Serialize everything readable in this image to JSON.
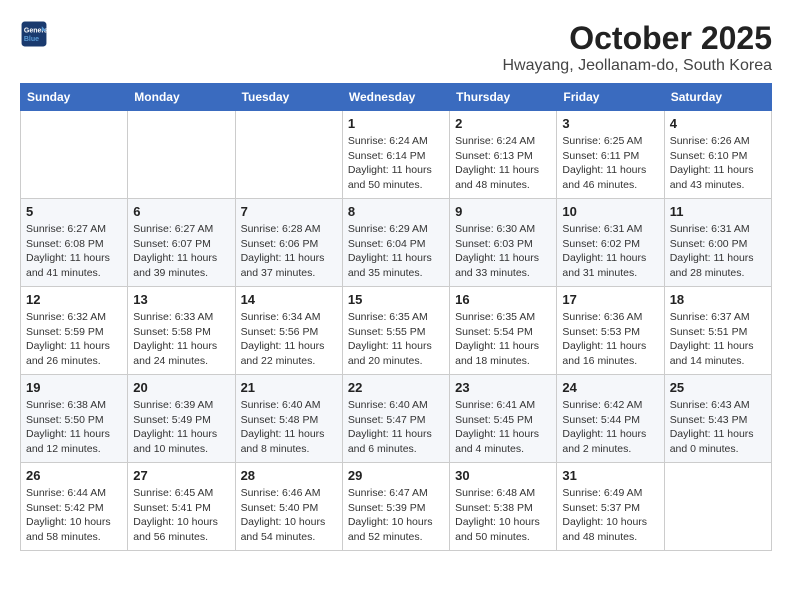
{
  "header": {
    "logo_line1": "General",
    "logo_line2": "Blue",
    "month": "October 2025",
    "location": "Hwayang, Jeollanam-do, South Korea"
  },
  "weekdays": [
    "Sunday",
    "Monday",
    "Tuesday",
    "Wednesday",
    "Thursday",
    "Friday",
    "Saturday"
  ],
  "weeks": [
    [
      {
        "day": "",
        "info": ""
      },
      {
        "day": "",
        "info": ""
      },
      {
        "day": "",
        "info": ""
      },
      {
        "day": "1",
        "info": "Sunrise: 6:24 AM\nSunset: 6:14 PM\nDaylight: 11 hours\nand 50 minutes."
      },
      {
        "day": "2",
        "info": "Sunrise: 6:24 AM\nSunset: 6:13 PM\nDaylight: 11 hours\nand 48 minutes."
      },
      {
        "day": "3",
        "info": "Sunrise: 6:25 AM\nSunset: 6:11 PM\nDaylight: 11 hours\nand 46 minutes."
      },
      {
        "day": "4",
        "info": "Sunrise: 6:26 AM\nSunset: 6:10 PM\nDaylight: 11 hours\nand 43 minutes."
      }
    ],
    [
      {
        "day": "5",
        "info": "Sunrise: 6:27 AM\nSunset: 6:08 PM\nDaylight: 11 hours\nand 41 minutes."
      },
      {
        "day": "6",
        "info": "Sunrise: 6:27 AM\nSunset: 6:07 PM\nDaylight: 11 hours\nand 39 minutes."
      },
      {
        "day": "7",
        "info": "Sunrise: 6:28 AM\nSunset: 6:06 PM\nDaylight: 11 hours\nand 37 minutes."
      },
      {
        "day": "8",
        "info": "Sunrise: 6:29 AM\nSunset: 6:04 PM\nDaylight: 11 hours\nand 35 minutes."
      },
      {
        "day": "9",
        "info": "Sunrise: 6:30 AM\nSunset: 6:03 PM\nDaylight: 11 hours\nand 33 minutes."
      },
      {
        "day": "10",
        "info": "Sunrise: 6:31 AM\nSunset: 6:02 PM\nDaylight: 11 hours\nand 31 minutes."
      },
      {
        "day": "11",
        "info": "Sunrise: 6:31 AM\nSunset: 6:00 PM\nDaylight: 11 hours\nand 28 minutes."
      }
    ],
    [
      {
        "day": "12",
        "info": "Sunrise: 6:32 AM\nSunset: 5:59 PM\nDaylight: 11 hours\nand 26 minutes."
      },
      {
        "day": "13",
        "info": "Sunrise: 6:33 AM\nSunset: 5:58 PM\nDaylight: 11 hours\nand 24 minutes."
      },
      {
        "day": "14",
        "info": "Sunrise: 6:34 AM\nSunset: 5:56 PM\nDaylight: 11 hours\nand 22 minutes."
      },
      {
        "day": "15",
        "info": "Sunrise: 6:35 AM\nSunset: 5:55 PM\nDaylight: 11 hours\nand 20 minutes."
      },
      {
        "day": "16",
        "info": "Sunrise: 6:35 AM\nSunset: 5:54 PM\nDaylight: 11 hours\nand 18 minutes."
      },
      {
        "day": "17",
        "info": "Sunrise: 6:36 AM\nSunset: 5:53 PM\nDaylight: 11 hours\nand 16 minutes."
      },
      {
        "day": "18",
        "info": "Sunrise: 6:37 AM\nSunset: 5:51 PM\nDaylight: 11 hours\nand 14 minutes."
      }
    ],
    [
      {
        "day": "19",
        "info": "Sunrise: 6:38 AM\nSunset: 5:50 PM\nDaylight: 11 hours\nand 12 minutes."
      },
      {
        "day": "20",
        "info": "Sunrise: 6:39 AM\nSunset: 5:49 PM\nDaylight: 11 hours\nand 10 minutes."
      },
      {
        "day": "21",
        "info": "Sunrise: 6:40 AM\nSunset: 5:48 PM\nDaylight: 11 hours\nand 8 minutes."
      },
      {
        "day": "22",
        "info": "Sunrise: 6:40 AM\nSunset: 5:47 PM\nDaylight: 11 hours\nand 6 minutes."
      },
      {
        "day": "23",
        "info": "Sunrise: 6:41 AM\nSunset: 5:45 PM\nDaylight: 11 hours\nand 4 minutes."
      },
      {
        "day": "24",
        "info": "Sunrise: 6:42 AM\nSunset: 5:44 PM\nDaylight: 11 hours\nand 2 minutes."
      },
      {
        "day": "25",
        "info": "Sunrise: 6:43 AM\nSunset: 5:43 PM\nDaylight: 11 hours\nand 0 minutes."
      }
    ],
    [
      {
        "day": "26",
        "info": "Sunrise: 6:44 AM\nSunset: 5:42 PM\nDaylight: 10 hours\nand 58 minutes."
      },
      {
        "day": "27",
        "info": "Sunrise: 6:45 AM\nSunset: 5:41 PM\nDaylight: 10 hours\nand 56 minutes."
      },
      {
        "day": "28",
        "info": "Sunrise: 6:46 AM\nSunset: 5:40 PM\nDaylight: 10 hours\nand 54 minutes."
      },
      {
        "day": "29",
        "info": "Sunrise: 6:47 AM\nSunset: 5:39 PM\nDaylight: 10 hours\nand 52 minutes."
      },
      {
        "day": "30",
        "info": "Sunrise: 6:48 AM\nSunset: 5:38 PM\nDaylight: 10 hours\nand 50 minutes."
      },
      {
        "day": "31",
        "info": "Sunrise: 6:49 AM\nSunset: 5:37 PM\nDaylight: 10 hours\nand 48 minutes."
      },
      {
        "day": "",
        "info": ""
      }
    ]
  ]
}
